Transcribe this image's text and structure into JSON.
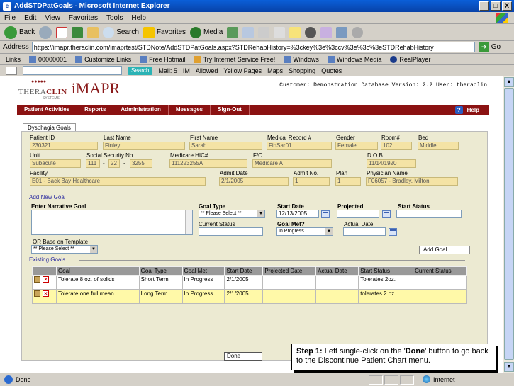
{
  "window": {
    "title": "AddSTDPatGoals - Microsoft Internet Explorer",
    "controls": [
      "_",
      "□",
      "X"
    ]
  },
  "menu": [
    "File",
    "Edit",
    "View",
    "Favorites",
    "Tools",
    "Help"
  ],
  "toolbar": {
    "back": "Back",
    "search": "Search",
    "favorites": "Favorites",
    "media": "Media"
  },
  "address": {
    "label": "Address",
    "url": "https://imapr.theraclin.com/imaprtest/STDNote/AddSTDPatGoals.aspx?STDRehabHistory=%3ckey%3e%3ccv%3e%3c%3eSTDRehabHistory",
    "go": "Go"
  },
  "links": {
    "label": "Links",
    "items": [
      "00000001",
      "Customize Links",
      "Free Hotmail",
      "Try Internet Service Free!",
      "Windows",
      "Windows Media",
      "RealPlayer"
    ]
  },
  "ybar": {
    "search": "Search",
    "mail": "Mail: 5",
    "im": "IM",
    "allowed": "Allowed",
    "items": [
      "Yellow Pages",
      "Maps",
      "Shopping",
      "Quotes"
    ]
  },
  "app": {
    "logo_left": "THERA",
    "logo_right": "CLIN",
    "logo_sub": "SYSTEMS",
    "logo_brand": "iMAPR",
    "customer_info": "Customer: Demonstration Database Version: 2.2 User: theraclin",
    "nav": [
      "Patient Activities",
      "Reports",
      "Administration",
      "Messages",
      "Sign-Out"
    ],
    "help": "Help",
    "tab": "Dysphagia Goals"
  },
  "patient": {
    "labels": {
      "patient_id": "Patient ID",
      "last_name": "Last Name",
      "first_name": "First Name",
      "mrn": "Medical Record #",
      "gender": "Gender",
      "room": "Room#",
      "bed": "Bed",
      "unit": "Unit",
      "ssn": "Social Security No.",
      "medicare": "Medicare HIC#",
      "fc": "F/C",
      "dob": "D.O.B.",
      "facility": "Facility",
      "admit_date": "Admit Date",
      "admit_no": "Admit No.",
      "plan": "Plan",
      "physician": "Physician Name"
    },
    "values": {
      "patient_id": "230321",
      "last_name": "Finley",
      "first_name": "Sarah",
      "mrn": "FinSar01",
      "gender": "Female",
      "room": "102",
      "bed": "Middle",
      "unit": "Subacute",
      "ssn1": "111",
      "ssn2": "22",
      "ssn3": "3255",
      "medicare": "111223255A",
      "fc": "Medicare A",
      "dob": "11/14/1920",
      "facility": "E01 - Back Bay Healthcare",
      "admit_date": "2/1/2005",
      "admit_no": "1",
      "plan": "1",
      "physician": "F06057 - Bradley, Milton"
    }
  },
  "add_goal": {
    "section": "Add New Goal",
    "narrative_label": "Enter Narrative Goal",
    "goal_type_label": "Goal Type",
    "goal_type_value": "** Please Select **",
    "start_date_label": "Start Date",
    "start_date_value": "12/13/2005",
    "projected_label": "Projected",
    "start_status_label": "Start Status",
    "current_status_label": "Current Status",
    "goal_met_label": "Goal Met?",
    "goal_met_value": "In Progress",
    "actual_date_label": "Actual Date",
    "template_label": "OR Base on Template",
    "template_value": "** Please Select **",
    "add_button": "Add Goal"
  },
  "existing": {
    "section": "Existing Goals",
    "columns": [
      "Goal",
      "Goal Type",
      "Goal Met",
      "Start Date",
      "Projected Date",
      "Actual Date",
      "Start Status",
      "Current Status"
    ],
    "rows": [
      {
        "goal": "Tolerate 8 oz. of solids",
        "type": "Short Term",
        "met": "In Progress",
        "start": "2/1/2005",
        "projected": "",
        "actual": "",
        "start_status": "Tolerates 2oz.",
        "current_status": ""
      },
      {
        "goal": "Tolerate one full mean",
        "type": "Long Term",
        "met": "In Progress",
        "start": "2/1/2005",
        "projected": "",
        "actual": "",
        "start_status": "tolerates 2 oz.",
        "current_status": ""
      }
    ]
  },
  "done_button": "Done",
  "callout": {
    "prefix": "Step 1:",
    "text_a": " Left single-click on the '",
    "bold": "Done",
    "text_b": "' button to go back to the Discontinue Patient Chart menu."
  },
  "status": {
    "left": "Done",
    "zone": "Internet"
  }
}
